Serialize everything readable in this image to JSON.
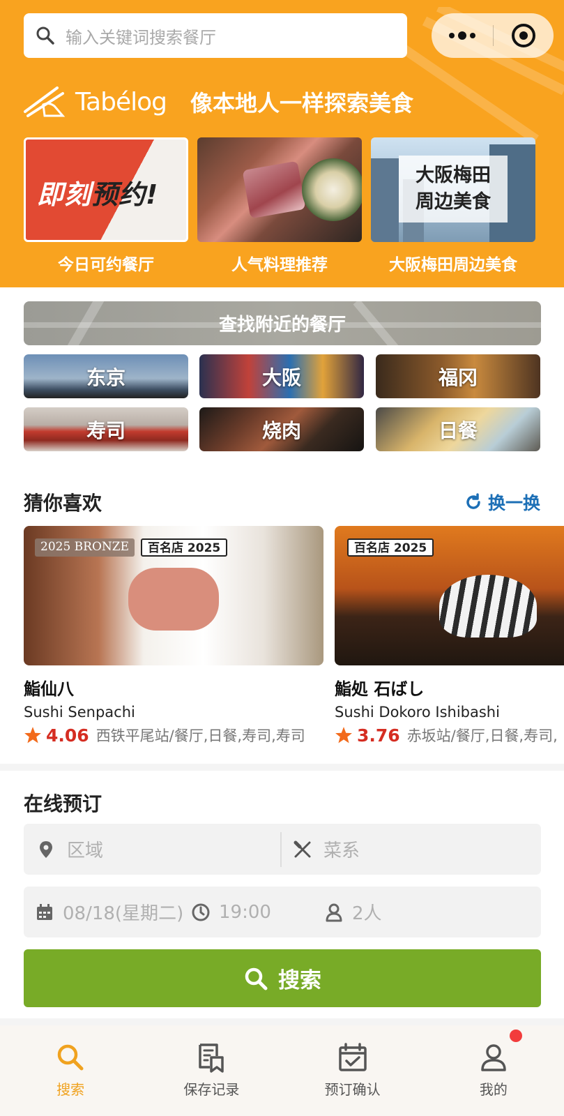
{
  "colors": {
    "header": "#f9a31f",
    "accent_blue": "#1c6fb6",
    "score_red": "#d52d22",
    "search_green": "#78ab27",
    "tab_active": "#f0a21f"
  },
  "search": {
    "placeholder": "输入关键词搜索餐厅"
  },
  "brand": {
    "logo": "Tabélog",
    "slogan": "像本地人一样探索美食"
  },
  "banners": [
    {
      "caption": "今日可约餐厅",
      "art_text_1": "即刻",
      "art_text_2": "预约!"
    },
    {
      "caption": "人气料理推荐"
    },
    {
      "caption": "大阪梅田周边美食",
      "art_line_1": "大阪梅田",
      "art_line_2": "周边美食"
    }
  ],
  "near": {
    "label": "查找附近的餐厅"
  },
  "tiles": [
    "东京",
    "大阪",
    "福冈",
    "寿司",
    "烧肉",
    "日餐"
  ],
  "recommend": {
    "title": "猜你喜欢",
    "refresh": "换一换",
    "cards": [
      {
        "badge_bronze": "2025 BRONZE",
        "badge_hyaku": "百名店 2025",
        "name": "鮨仙八",
        "en": "Sushi Senpachi",
        "score": "4.06",
        "area": "西铁平尾站/餐厅,日餐,寿司,寿司"
      },
      {
        "badge_hyaku": "百名店 2025",
        "name": "鮨処 石ばし",
        "en": "Sushi Dokoro Ishibashi",
        "score": "3.76",
        "area": "赤坂站/餐厅,日餐,寿司,"
      }
    ]
  },
  "booking": {
    "title": "在线预订",
    "area_placeholder": "区域",
    "cuisine_placeholder": "菜系",
    "date": "08/18(星期二)",
    "time": "19:00",
    "people": "2人",
    "search_label": "搜索"
  },
  "tabs": [
    {
      "label": "搜索",
      "icon": "search-icon",
      "active": true
    },
    {
      "label": "保存记录",
      "icon": "saved-icon"
    },
    {
      "label": "预订确认",
      "icon": "calendar-check-icon"
    },
    {
      "label": "我的",
      "icon": "user-icon",
      "notification_dot": true
    }
  ]
}
